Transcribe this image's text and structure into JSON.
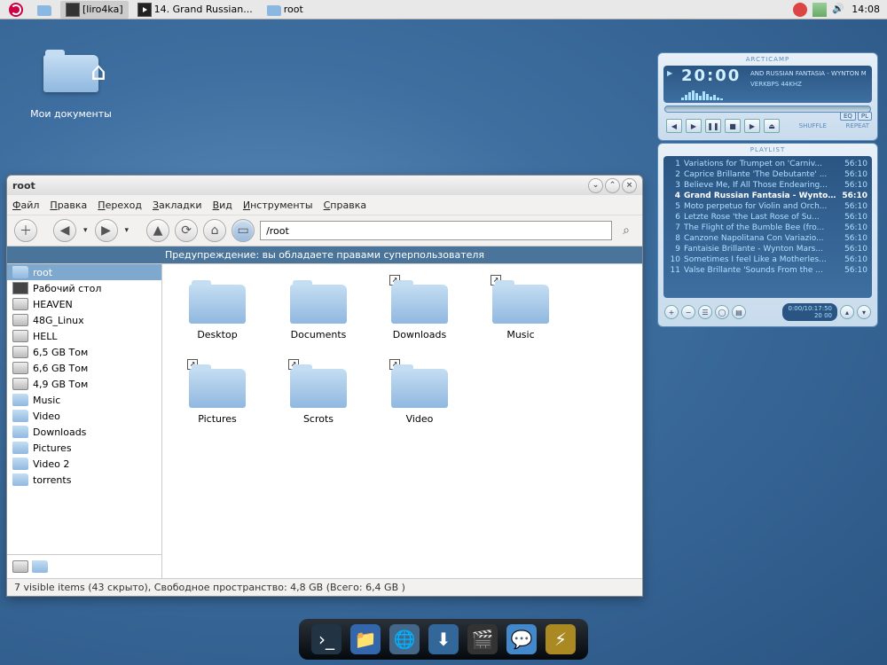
{
  "panel": {
    "taskbar": [
      {
        "label": "[liro4ka]"
      },
      {
        "label": "14. Grand Russian..."
      },
      {
        "label": "root"
      }
    ],
    "clock": "14:08"
  },
  "desktop": {
    "icon_label": "Мои документы"
  },
  "fm": {
    "title": "root",
    "menu": [
      "Файл",
      "Правка",
      "Переход",
      "Закладки",
      "Вид",
      "Инструменты",
      "Справка"
    ],
    "path": "/root",
    "warning": "Предупреждение: вы обладаете правами суперпользователя",
    "sidebar": [
      {
        "label": "root",
        "type": "home",
        "selected": true
      },
      {
        "label": "Рабочий стол",
        "type": "desktop"
      },
      {
        "label": "HEAVEN",
        "type": "drive"
      },
      {
        "label": "48G_Linux",
        "type": "drive"
      },
      {
        "label": "HELL",
        "type": "drive"
      },
      {
        "label": "6,5 GB Том",
        "type": "drive"
      },
      {
        "label": "6,6 GB Том",
        "type": "drive"
      },
      {
        "label": "4,9 GB Том",
        "type": "drive"
      },
      {
        "label": "Music",
        "type": "folder"
      },
      {
        "label": "Video",
        "type": "folder"
      },
      {
        "label": "Downloads",
        "type": "folder"
      },
      {
        "label": "Pictures",
        "type": "folder"
      },
      {
        "label": "Video 2",
        "type": "folder"
      },
      {
        "label": "torrents",
        "type": "folder"
      }
    ],
    "files": [
      {
        "label": "Desktop",
        "emblem": false
      },
      {
        "label": "Documents",
        "emblem": false
      },
      {
        "label": "Downloads",
        "emblem": true
      },
      {
        "label": "Music",
        "emblem": true
      },
      {
        "label": "Pictures",
        "emblem": true
      },
      {
        "label": "Scrots",
        "emblem": true
      },
      {
        "label": "Video",
        "emblem": true
      }
    ],
    "status": "7 visible items (43 скрыто), Свободное пространство: 4,8 GB (Всего: 6,4 GB )"
  },
  "player": {
    "title": "ARCTICAMP",
    "time": "20:00",
    "track": "AND RUSSIAN FANTASIA - WYNTON M",
    "bitrate": "VERKBPS  44KHZ",
    "shuffle": "SHUFFLE",
    "repeat": "REPEAT",
    "eq": "EQ",
    "pl": "PL",
    "playlist_title": "PLAYLIST",
    "playlist": [
      {
        "n": "1",
        "t": "Variations for Trumpet on 'Carniv...",
        "d": "56:10"
      },
      {
        "n": "2",
        "t": "Caprice Brillante 'The Debutante' ...",
        "d": "56:10"
      },
      {
        "n": "3",
        "t": "Believe Me, If All Those Endearing...",
        "d": "56:10"
      },
      {
        "n": "4",
        "t": "Grand Russian Fantasia - Wynton ...",
        "d": "56:10",
        "current": true
      },
      {
        "n": "5",
        "t": "Moto perpetuo for Violin and Orch...",
        "d": "56:10"
      },
      {
        "n": "6",
        "t": "Letzte Rose 'the Last Rose of Su...",
        "d": "56:10"
      },
      {
        "n": "7",
        "t": "The Flight of the Bumble Bee (fro...",
        "d": "56:10"
      },
      {
        "n": "8",
        "t": "Canzone Napolitana Con Variazio...",
        "d": "56:10"
      },
      {
        "n": "9",
        "t": "Fantaisie Brillante - Wynton Mars...",
        "d": "56:10"
      },
      {
        "n": "10",
        "t": "Sometimes I feel Like a Motherles...",
        "d": "56:10"
      },
      {
        "n": "11",
        "t": "Valse Brillante 'Sounds From the ...",
        "d": "56:10"
      }
    ],
    "total_time": "0:00/10:17:50",
    "total_sub": "20 00"
  }
}
